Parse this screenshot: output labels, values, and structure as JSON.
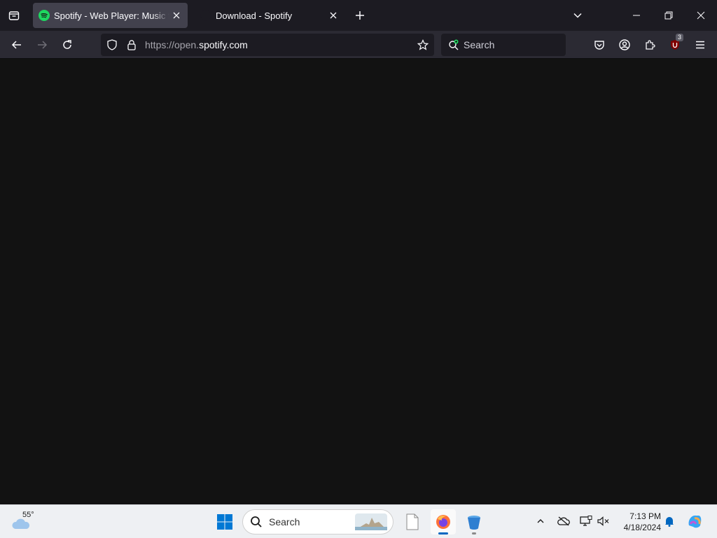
{
  "browser": {
    "tabs": [
      {
        "title": "Spotify - Web Player: Music for everyone",
        "active": true,
        "favicon": "spotify-icon"
      },
      {
        "title": "Download - Spotify",
        "active": false,
        "favicon": "spotify-dark-icon"
      }
    ],
    "url": {
      "prefix": "https://open.",
      "domain": "spotify.com"
    },
    "search_placeholder": "Search",
    "extension_badge": "3",
    "accent_color": "#1ed760"
  },
  "taskbar": {
    "weather_temp": "55°",
    "search_placeholder": "Search",
    "clock": {
      "time": "7:13 PM",
      "date": "4/18/2024"
    }
  }
}
